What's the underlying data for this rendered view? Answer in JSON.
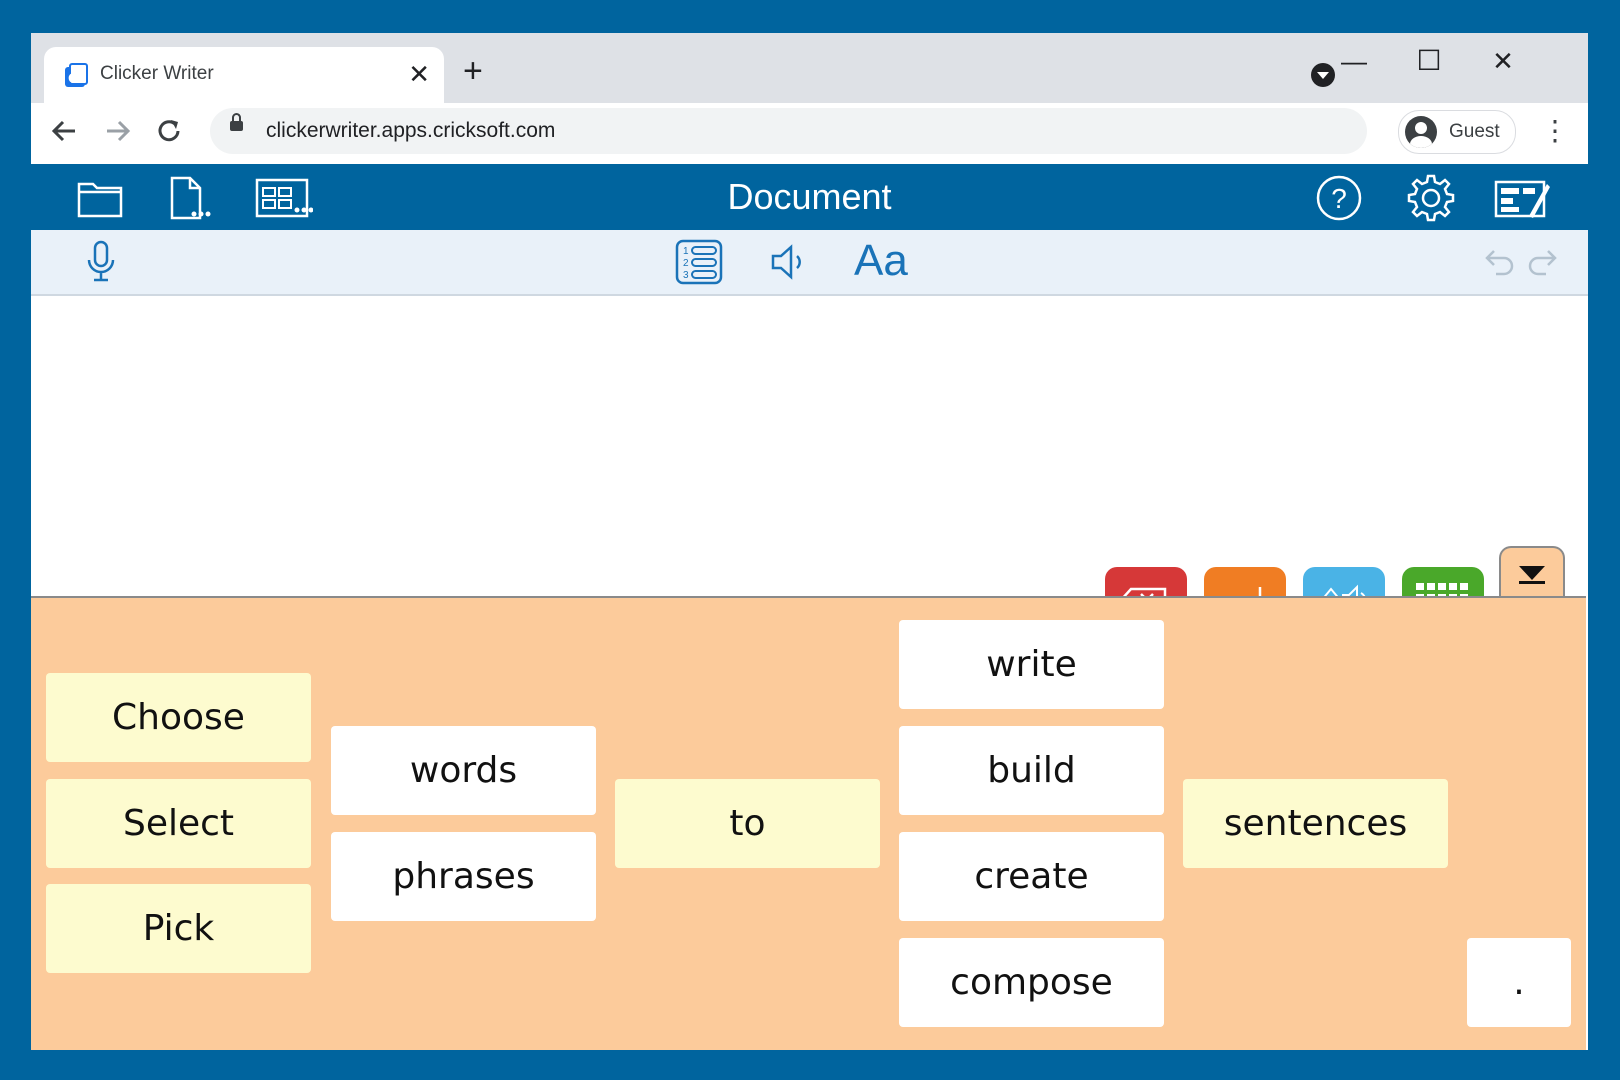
{
  "browser": {
    "tab_title": "Clicker Writer",
    "tab_close": "✕",
    "new_tab": "+",
    "url": "clickerwriter.apps.cricksoft.com",
    "profile_label": "Guest",
    "minimize": "—",
    "maximize": "☐",
    "close": "✕"
  },
  "app": {
    "title": "Document"
  },
  "grid": {
    "col1": [
      "Choose",
      "Select",
      "Pick"
    ],
    "col2": [
      "words",
      "phrases"
    ],
    "col3": [
      "to"
    ],
    "col4": [
      "write",
      "build",
      "create",
      "compose"
    ],
    "col5": [
      "sentences"
    ],
    "punctuation": "."
  },
  "colors": {
    "brand_blue": "#00649e",
    "delete": "#d63838",
    "enter": "#f07d23",
    "speak": "#4ab3e6",
    "keyboard": "#4aa82a",
    "grid_bg": "#fccb9b",
    "cell_yellow": "#fdfbcf"
  },
  "icons": {
    "open": "folder-icon",
    "new": "new-document-icon",
    "sets": "grid-sets-icon",
    "help": "help-icon",
    "settings": "gear-icon",
    "edit": "edit-grid-icon",
    "mic": "microphone-icon",
    "list": "numbered-list-icon",
    "speaker": "speaker-icon",
    "undo": "undo-icon",
    "redo": "redo-icon"
  }
}
